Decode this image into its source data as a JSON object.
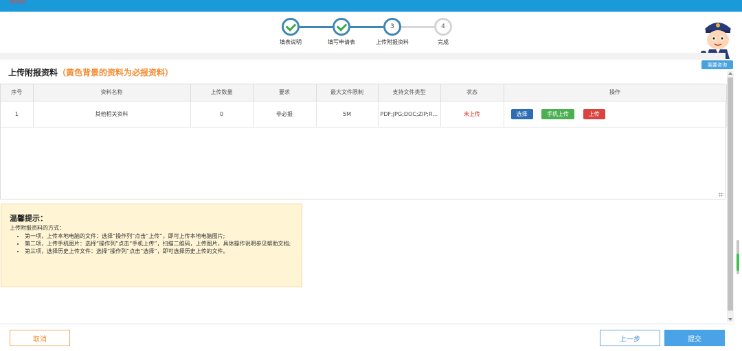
{
  "header": {
    "brand": "智慧税务"
  },
  "steps": [
    {
      "label": "填表说明",
      "number": "",
      "state": "done"
    },
    {
      "label": "填写申请表",
      "number": "",
      "state": "done"
    },
    {
      "label": "上传附报资料",
      "number": "3",
      "state": "current"
    },
    {
      "label": "完成",
      "number": "4",
      "state": "todo"
    }
  ],
  "assistant": {
    "consult_label": "我要咨询"
  },
  "section": {
    "title": "上传附报资料",
    "note": "（黄色背景的资料为必报资料）"
  },
  "table": {
    "columns": [
      "序号",
      "资料名称",
      "上传数量",
      "要求",
      "最大文件限制",
      "支持文件类型",
      "状态",
      "操作"
    ],
    "rows": [
      {
        "index": "1",
        "name": "其他相关资料",
        "count": "0",
        "requirement": "非必报",
        "max_size": "5M",
        "file_types": "PDF;JPG;DOC;ZIP;RAR",
        "status": "未上传",
        "actions": {
          "select": "选择",
          "mobile_upload": "手机上传",
          "upload": "上传"
        }
      }
    ]
  },
  "tips": {
    "title": "温馨提示：",
    "subtitle": "上传附报资料的方式：",
    "items": [
      "第一项，上传本地电脑的文件：选择“操作列”点击“上传”，即可上传本地电脑图片;",
      "第二项，上传手机图片：选择“操作列”点击“手机上传”，扫描二维码，上传图片，具体操作说明参见帮助文档;",
      "第三项，选择历史上传文件：选择“操作列”点击“选择”，即可选择历史上传的文件。"
    ]
  },
  "footer": {
    "cancel": "取消",
    "prev": "上一步",
    "submit": "提交"
  },
  "colors": {
    "primary": "#1b9ad9",
    "step": "#3e86b4",
    "check": "#3fa74b",
    "warning": "#f28a2f",
    "danger": "#e2231a"
  }
}
